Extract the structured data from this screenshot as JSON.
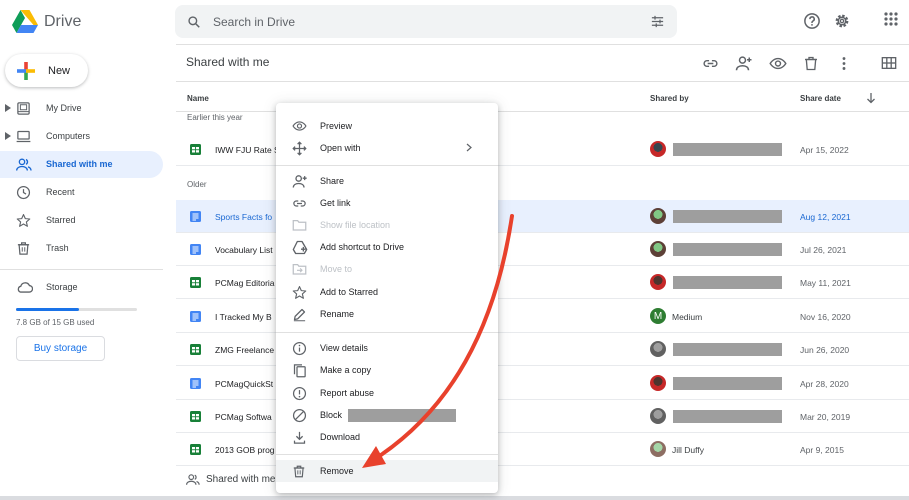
{
  "app": {
    "name": "Drive",
    "search_placeholder": "Search in Drive"
  },
  "sidebar": {
    "new_label": "New",
    "items": [
      {
        "label": "My Drive",
        "icon": "my-drive-icon"
      },
      {
        "label": "Computers",
        "icon": "computer-icon"
      },
      {
        "label": "Shared with me",
        "icon": "people-icon",
        "active": true
      },
      {
        "label": "Recent",
        "icon": "clock-icon"
      },
      {
        "label": "Starred",
        "icon": "star-icon"
      },
      {
        "label": "Trash",
        "icon": "trash-icon"
      }
    ],
    "storage_label": "Storage",
    "storage_used": "7.8 GB of 15 GB used",
    "storage_fraction": 0.52,
    "buy_label": "Buy storage"
  },
  "main": {
    "title": "Shared with me",
    "columns": {
      "name": "Name",
      "shared_by": "Shared by",
      "share_date": "Share date"
    },
    "sections": {
      "earlier": "Earlier this year",
      "older": "Older"
    },
    "files": [
      {
        "name": "IWW FJU Rate S",
        "type": "sheet",
        "shared_by": "",
        "date": "Apr 15, 2022"
      },
      {
        "name": "Sports Facts fo",
        "type": "doc",
        "shared_by": "",
        "date": "Aug 12, 2021",
        "selected": true
      },
      {
        "name": "Vocabulary List",
        "type": "doc",
        "shared_by": "",
        "date": "Jul 26, 2021"
      },
      {
        "name": "PCMag Editoria",
        "type": "sheet",
        "shared_by": "",
        "date": "May 11, 2021"
      },
      {
        "name": "I Tracked My B",
        "type": "doc",
        "shared_by": "Medium",
        "date": "Nov 16, 2020"
      },
      {
        "name": "ZMG Freelance",
        "type": "sheet",
        "shared_by": "",
        "date": "Jun 26, 2020"
      },
      {
        "name": "PCMagQuickSt",
        "type": "doc",
        "shared_by": "",
        "date": "Apr 28, 2020"
      },
      {
        "name": "PCMag Softwa",
        "type": "sheet",
        "shared_by": "",
        "date": "Mar 20, 2019"
      },
      {
        "name": "2013 GOB prog",
        "type": "sheet",
        "shared_by": "Jill Duffy",
        "date": "Apr 9, 2015"
      }
    ],
    "footer_label": "Shared with me"
  },
  "menu": {
    "preview": "Preview",
    "open_with": "Open with",
    "share": "Share",
    "get_link": "Get link",
    "show_location": "Show file location",
    "add_shortcut": "Add shortcut to Drive",
    "move_to": "Move to",
    "add_starred": "Add to Starred",
    "rename": "Rename",
    "view_details": "View details",
    "make_copy": "Make a copy",
    "report_abuse": "Report abuse",
    "block": "Block",
    "download": "Download",
    "remove": "Remove"
  },
  "colors": {
    "accent": "#1a73e8",
    "selected_bg": "#e8f0fe",
    "sheet_green": "#188038",
    "doc_blue": "#4285f4",
    "arrow_red": "#e8412c"
  }
}
